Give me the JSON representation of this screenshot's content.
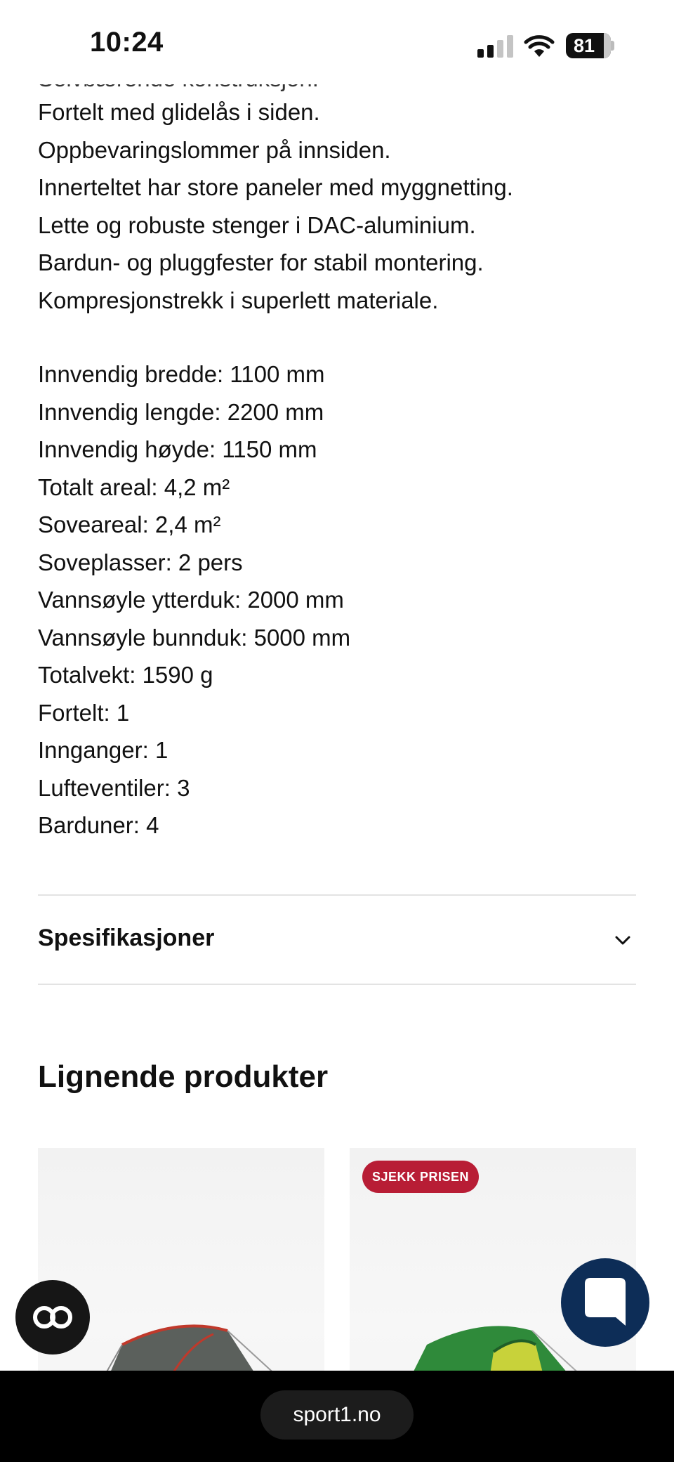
{
  "status_bar": {
    "time": "10:24",
    "battery_level": "81",
    "signal_bars_active": 2,
    "icons": [
      "signal-icon",
      "wifi-icon",
      "battery-icon"
    ]
  },
  "description": {
    "clipped_line": "Selvbærende konstruksjon.",
    "features": [
      "Fortelt med glidelås i siden.",
      "Oppbevaringslommer på innsiden.",
      "Innerteltet har store paneler med myggnetting.",
      "Lette og robuste stenger i DAC-aluminium.",
      "Bardun- og pluggfester for stabil montering.",
      "Kompresjonstrekk i superlett materiale."
    ],
    "specs": [
      "Innvendig bredde: 1100 mm",
      "Innvendig lengde: 2200 mm",
      "Innvendig høyde: 1150 mm",
      "Totalt areal: 4,2 m²",
      "Soveareal: 2,4 m²",
      "Soveplasser: 2 pers",
      "Vannsøyle ytterduk: 2000 mm",
      "Vannsøyle bunnduk: 5000 mm",
      "Totalvekt: 1590 g",
      "Fortelt: 1",
      "Innganger: 1",
      "Lufteventiler: 3",
      "Barduner: 4"
    ]
  },
  "accordion": {
    "label": "Spesifikasjoner",
    "icon": "chevron-down-icon"
  },
  "related": {
    "title": "Lignende produkter",
    "products": [
      {
        "image": "grey-tunnel-tent-image"
      },
      {
        "badge": "SJEKK PRISEN",
        "image": "green-tunnel-tent-image"
      }
    ]
  },
  "floating": {
    "left_icon": "glasses-icon",
    "right_icon": "chat-bubble-icon"
  },
  "browser": {
    "url": "sport1.no"
  },
  "colors": {
    "badge": "#b81d35",
    "chat_button": "#0d2d57",
    "tent_grey": "#5b605c",
    "tent_green": "#2f8a3a"
  }
}
